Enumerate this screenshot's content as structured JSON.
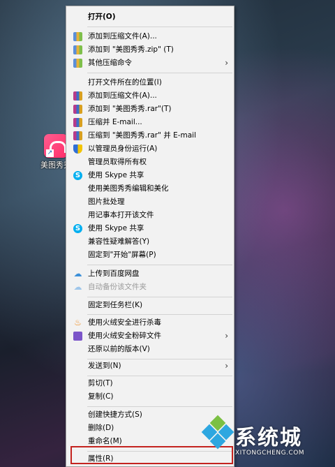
{
  "desktop": {
    "shortcut_label": "美图秀秀"
  },
  "menu": {
    "items": [
      {
        "label": "打开(O)",
        "icon": "none"
      },
      {
        "label": "添加到压缩文件(A)...",
        "icon": "zip-icon"
      },
      {
        "label": "添加到 \"美图秀秀.zip\" (T)",
        "icon": "zip-icon"
      },
      {
        "label": "其他压缩命令",
        "icon": "zip-icon",
        "submenu": true
      },
      {
        "label": "打开文件所在的位置(I)",
        "icon": "none"
      },
      {
        "label": "添加到压缩文件(A)...",
        "icon": "rar-icon"
      },
      {
        "label": "添加到 \"美图秀秀.rar\"(T)",
        "icon": "rar-icon"
      },
      {
        "label": "压缩并 E-mail...",
        "icon": "rar-icon"
      },
      {
        "label": "压缩到 \"美图秀秀.rar\" 并 E-mail",
        "icon": "rar-icon"
      },
      {
        "label": "以管理员身份运行(A)",
        "icon": "shield-icon"
      },
      {
        "label": "管理员取得所有权",
        "icon": "none"
      },
      {
        "label": "使用 Skype 共享",
        "icon": "skype-icon"
      },
      {
        "label": "使用美图秀秀编辑和美化",
        "icon": "none"
      },
      {
        "label": "图片批处理",
        "icon": "none"
      },
      {
        "label": "用记事本打开该文件",
        "icon": "none"
      },
      {
        "label": "使用 Skype 共享",
        "icon": "skype-icon"
      },
      {
        "label": "兼容性疑难解答(Y)",
        "icon": "none"
      },
      {
        "label": "固定到\"开始\"屏幕(P)",
        "icon": "none"
      },
      {
        "label": "上传到百度网盘",
        "icon": "baidu-cloud-icon"
      },
      {
        "label": "自动备份该文件夹",
        "icon": "baidu-cloud-icon",
        "disabled": true
      },
      {
        "label": "固定到任务栏(K)",
        "icon": "none"
      },
      {
        "label": "使用火绒安全进行杀毒",
        "icon": "huorong-fire-icon"
      },
      {
        "label": "使用火绒安全粉碎文件",
        "icon": "shredder-icon",
        "submenu": true
      },
      {
        "label": "还原以前的版本(V)",
        "icon": "none"
      },
      {
        "label": "发送到(N)",
        "icon": "none",
        "submenu": true
      },
      {
        "label": "剪切(T)",
        "icon": "none"
      },
      {
        "label": "复制(C)",
        "icon": "none"
      },
      {
        "label": "创建快捷方式(S)",
        "icon": "none"
      },
      {
        "label": "删除(D)",
        "icon": "none"
      },
      {
        "label": "重命名(M)",
        "icon": "none"
      },
      {
        "label": "属性(R)",
        "icon": "none"
      }
    ]
  },
  "watermark": {
    "title": "系统城",
    "url": "XITONGCHENG.COM"
  },
  "colors": {
    "highlight_border": "#c4231f",
    "menu_background": "#f2f2f2"
  }
}
